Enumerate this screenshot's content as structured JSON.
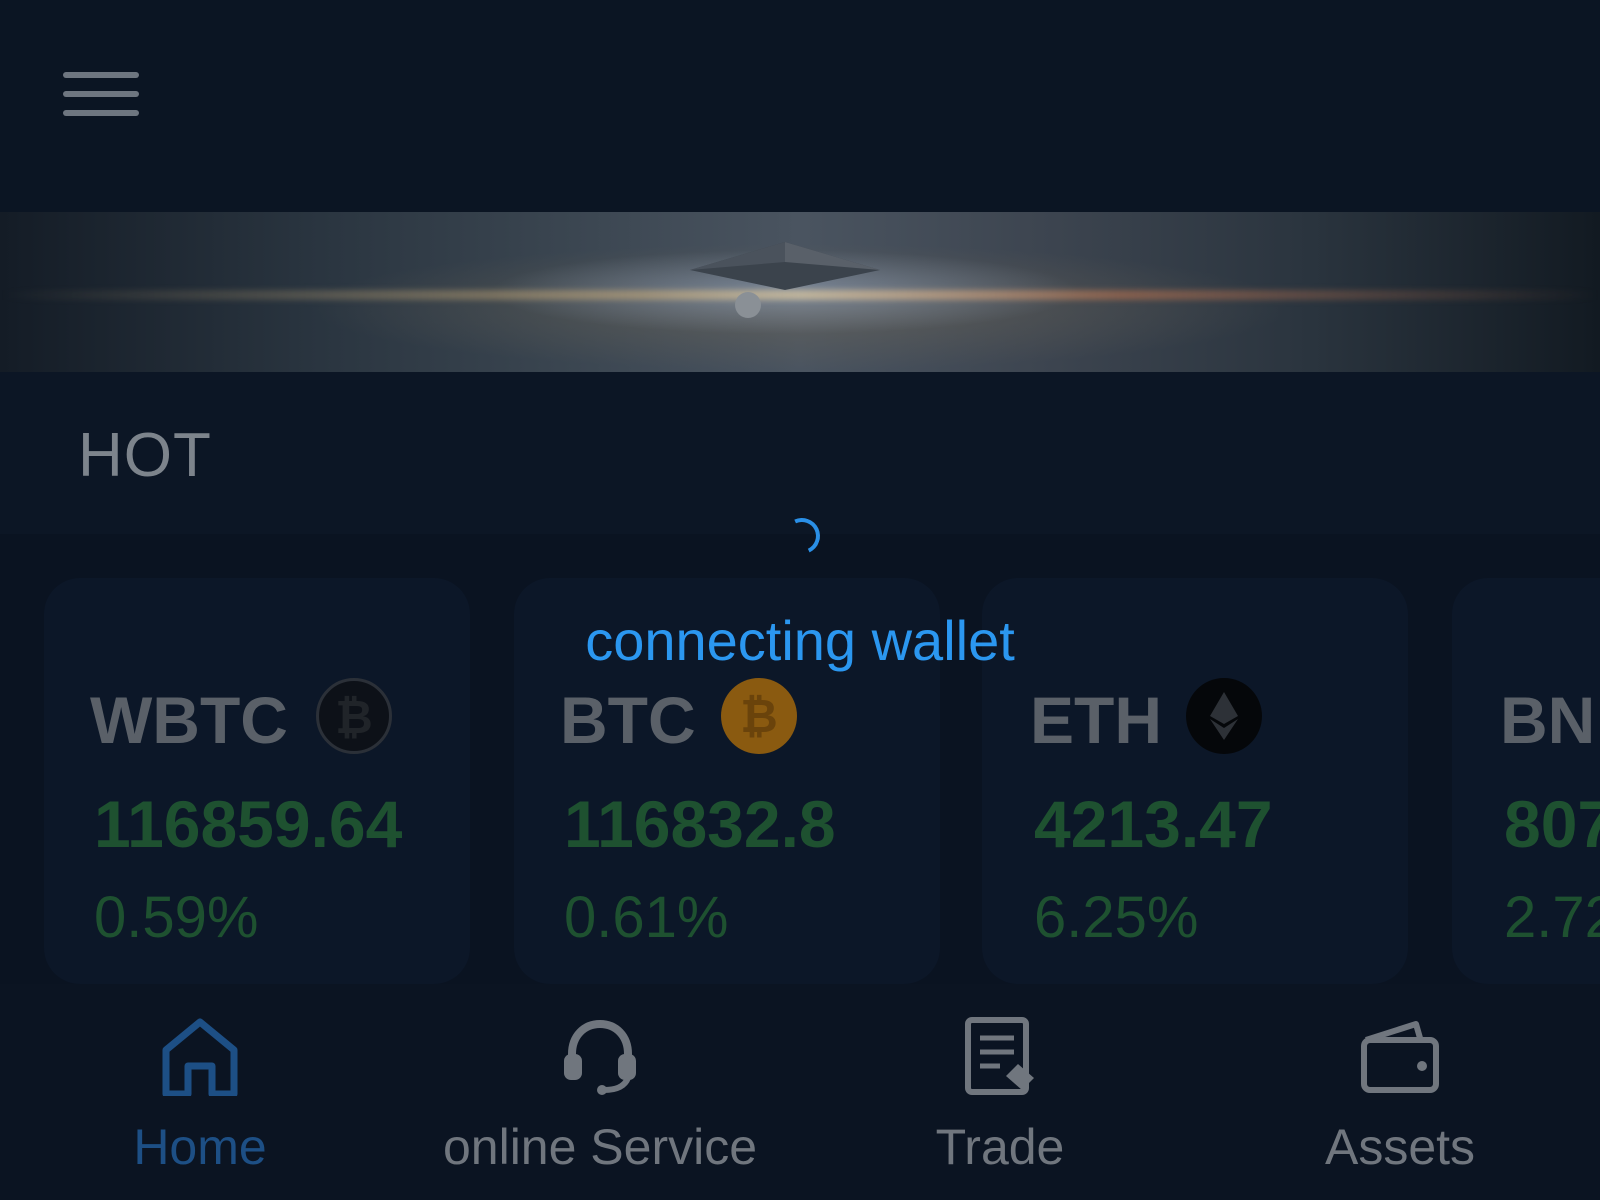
{
  "header": {
    "menu_icon": "hamburger-menu-icon"
  },
  "banner": {
    "image": "ethereum-banner-image"
  },
  "hot": {
    "title": "HOT"
  },
  "loading": {
    "text": "connecting wallet",
    "icon": "spinner-icon"
  },
  "cards": [
    {
      "symbol": "WBTC",
      "icon": "wbtc-coin-icon",
      "price": "116859.64",
      "change": "0.59%"
    },
    {
      "symbol": "BTC",
      "icon": "btc-coin-icon",
      "price": "116832.8",
      "change": "0.61%"
    },
    {
      "symbol": "ETH",
      "icon": "eth-coin-icon",
      "price": "4213.47",
      "change": "6.25%"
    },
    {
      "symbol": "BN",
      "icon": "",
      "price": "807",
      "change": "2.72"
    }
  ],
  "nav": [
    {
      "label": "Home",
      "icon": "home-icon",
      "active": true
    },
    {
      "label": "online Service",
      "icon": "headset-icon",
      "active": false
    },
    {
      "label": "Trade",
      "icon": "trade-document-icon",
      "active": false
    },
    {
      "label": "Assets",
      "icon": "wallet-icon",
      "active": false
    }
  ],
  "colors": {
    "accent": "#2b97f0",
    "positive": "#1e5130",
    "active_nav": "#1d4f85",
    "btc": "#8a5a10"
  }
}
